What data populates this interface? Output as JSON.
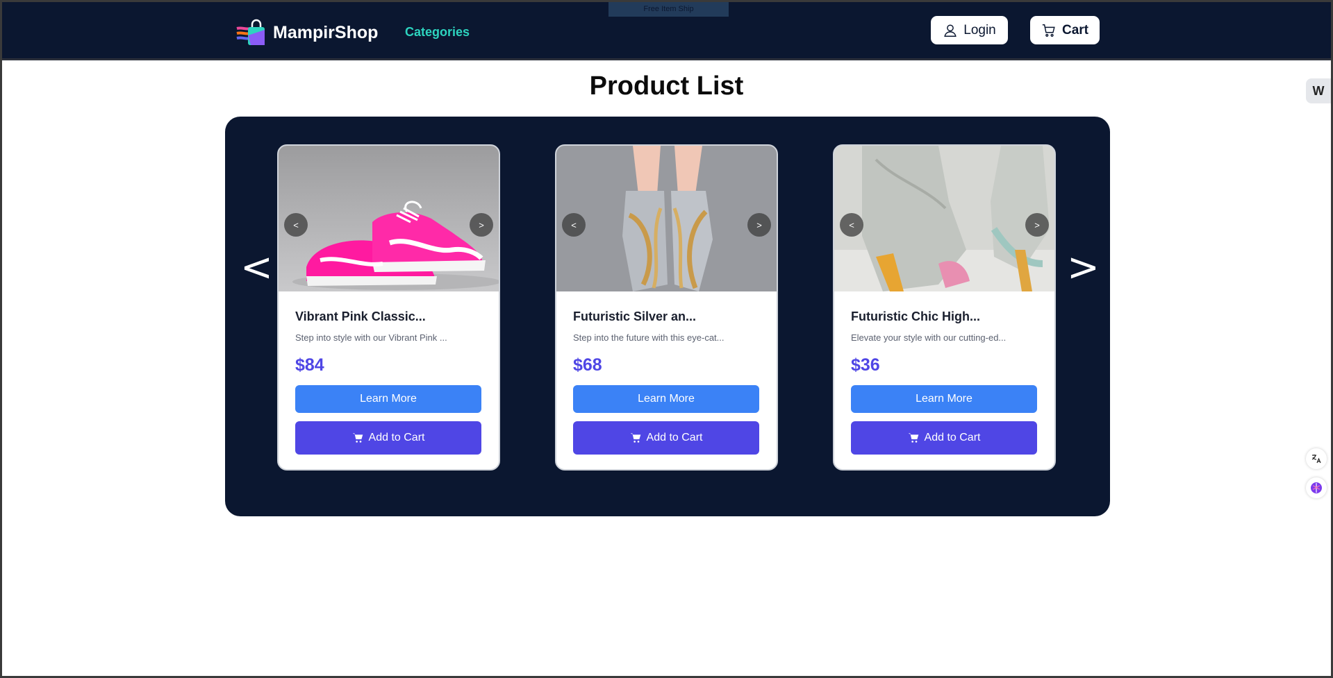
{
  "navbar": {
    "brand_name": "MampirShop",
    "categories_label": "Categories",
    "toast_text": "Free Item Ship",
    "login_label": "Login",
    "cart_label": "Cart"
  },
  "page": {
    "title": "Product List"
  },
  "carousel": {
    "prev_label": "<",
    "next_label": ">"
  },
  "products": [
    {
      "name": "Vibrant Pink Classic...",
      "description": "Step into style with our Vibrant Pink ...",
      "price": "$84",
      "learn_more_label": "Learn More",
      "add_to_cart_label": "Add to Cart",
      "img_prev": "<",
      "img_next": ">"
    },
    {
      "name": "Futuristic Silver an...",
      "description": "Step into the future with this eye-cat...",
      "price": "$68",
      "learn_more_label": "Learn More",
      "add_to_cart_label": "Add to Cart",
      "img_prev": "<",
      "img_next": ">"
    },
    {
      "name": "Futuristic Chic High...",
      "description": "Elevate your style with our cutting-ed...",
      "price": "$36",
      "learn_more_label": "Learn More",
      "add_to_cart_label": "Add to Cart",
      "img_prev": "<",
      "img_next": ">"
    }
  ],
  "side": {
    "tab_label": "W"
  },
  "colors": {
    "navbar_bg": "#0b1730",
    "categories": "#2dd4bf",
    "price": "#4f46e5",
    "learn_more": "#3b82f6",
    "add_to_cart": "#4f46e5"
  },
  "icons": [
    "shopping-bag-logo-icon",
    "user-icon",
    "cart-icon",
    "cart-icon",
    "translate-icon",
    "brain-icon"
  ]
}
